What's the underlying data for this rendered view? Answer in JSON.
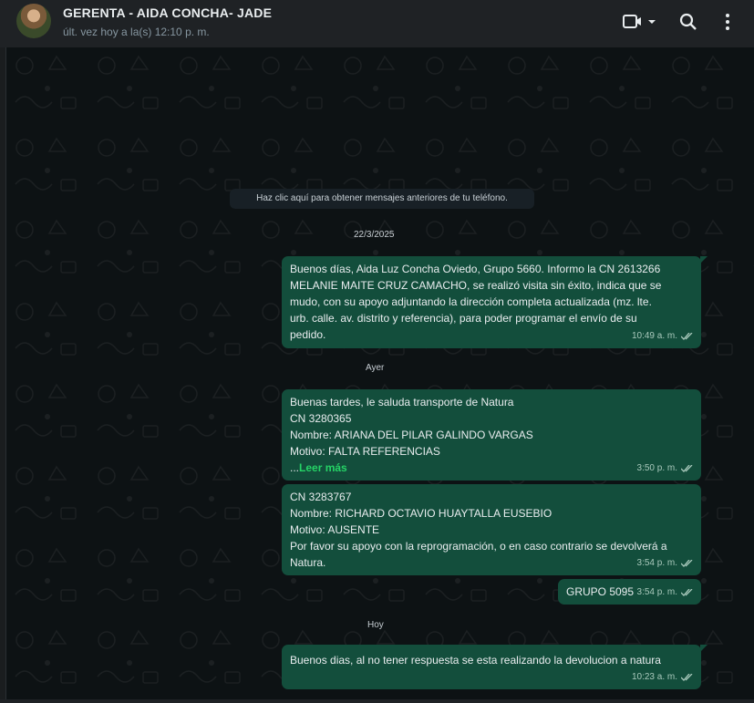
{
  "header": {
    "title": "GERENTA - AIDA CONCHA- JADE",
    "subtitle": "últ. vez hoy a la(s) 12:10 p. m.",
    "icons": [
      "video-call-icon",
      "search-icon",
      "menu-icon"
    ]
  },
  "chat": {
    "load_older": "Haz clic aquí para obtener mensajes anteriores de tu teléfono.",
    "dates": [
      "22/3/2025",
      "Ayer",
      "Hoy"
    ],
    "messages": [
      {
        "lines": [
          "Buenos días, Aida Luz Concha Oviedo, Grupo 5660. Informo la CN 2613266",
          "MELANIE MAITE CRUZ CAMACHO, se realizó visita sin éxito, indica que se",
          "mudo, con su apoyo adjuntando la dirección completa actualizada (mz. lte.",
          "urb. calle. av. distrito y referencia), para poder programar el envío de su",
          "pedido."
        ],
        "time": "10:49 a. m."
      },
      {
        "lines": [
          "Buenas tardes, le saluda transporte de Natura",
          "CN 3280365",
          "Nombre: ARIANA DEL PILAR GALINDO VARGAS",
          "Motivo: FALTA REFERENCIAS"
        ],
        "read_more_prefix": "...",
        "read_more": "Leer más",
        "time": "3:50 p. m."
      },
      {
        "lines": [
          "CN 3283767",
          "Nombre: RICHARD OCTAVIO HUAYTALLA EUSEBIO",
          "Motivo: AUSENTE",
          "Por favor su apoyo con la reprogramación, o en caso contrario se devolverá a",
          "Natura."
        ],
        "time": "3:54 p. m."
      },
      {
        "lines": [
          "GRUPO 5095"
        ],
        "time": "3:54 p. m."
      },
      {
        "lines": [
          "Buenos dias, al no tener respuesta se esta realizando la devolucion a natura"
        ],
        "time": "10:23 a. m."
      }
    ]
  },
  "colors": {
    "header_bg": "#1f2225",
    "chat_bg": "#0d1214",
    "bubble_out": "#134e3c",
    "read_more": "#25d366",
    "tick": "#a9c9bc"
  }
}
